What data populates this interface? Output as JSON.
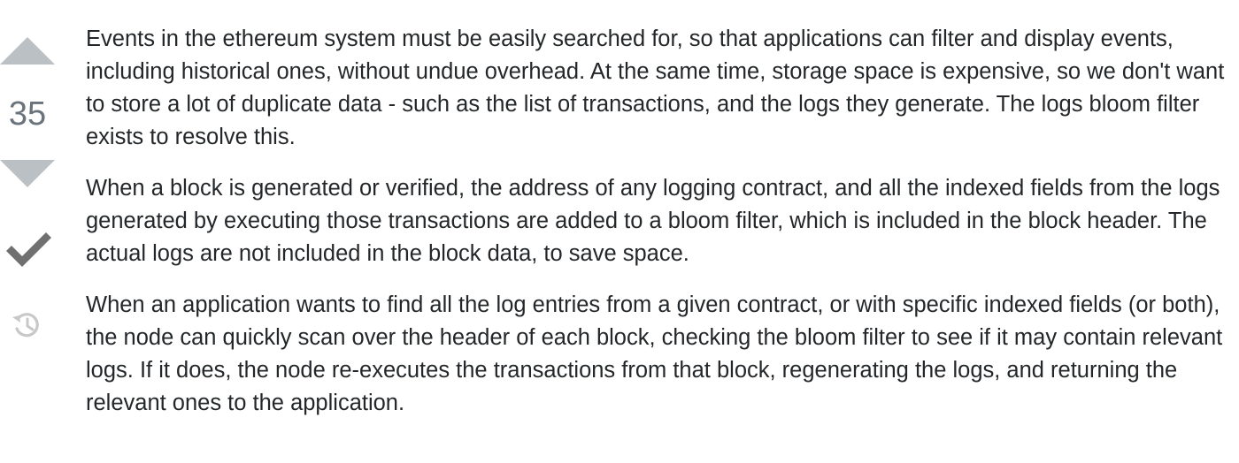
{
  "vote": {
    "count": "35"
  },
  "icons": {
    "upvote": "triangle-up-icon",
    "downvote": "triangle-down-icon",
    "accepted": "checkmark-icon",
    "history": "history-icon"
  },
  "colors": {
    "text": "#242729",
    "vote_arrow": "#bbc0c4",
    "vote_count": "#6a737c",
    "accepted_check": "#707070",
    "history_icon": "#c8c8c8"
  },
  "answer": {
    "paragraphs": [
      "Events in the ethereum system must be easily searched for, so that applications can filter and display events, including historical ones, without undue overhead. At the same time, storage space is expensive, so we don't want to store a lot of duplicate data - such as the list of transactions, and the logs they generate. The logs bloom filter exists to resolve this.",
      "When a block is generated or verified, the address of any logging contract, and all the indexed fields from the logs generated by executing those transactions are added to a bloom filter, which is included in the block header. The actual logs are not included in the block data, to save space.",
      "When an application wants to find all the log entries from a given contract, or with specific indexed fields (or both), the node can quickly scan over the header of each block, checking the bloom filter to see if it may contain relevant logs. If it does, the node re-executes the transactions from that block, regenerating the logs, and returning the relevant ones to the application."
    ]
  }
}
